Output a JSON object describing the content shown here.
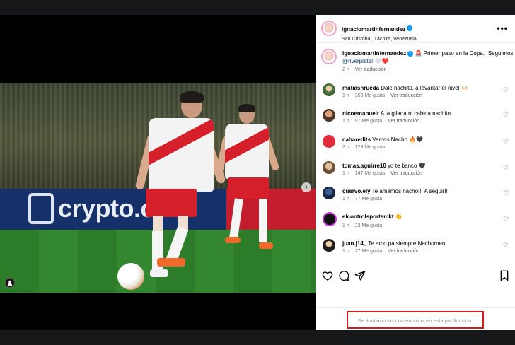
{
  "post": {
    "author": "ignaciomartinfernandez",
    "location": "San Cristóbal, Táchira, Venezuela",
    "caption_text": "🚨 Primer paso en la Copa. ¡Seguimos,",
    "caption_mention": "@riverplate!",
    "caption_emoji": "🤍❤️",
    "caption_time": "2 h",
    "caption_translate": "Ver traducción",
    "more_label": "•••"
  },
  "media": {
    "ad_text": "crypto.c",
    "next_glyph": "›",
    "tag_glyph": "👤"
  },
  "comments": [
    {
      "user": "matiasnrueda",
      "text": "Dale nachito, a levantar el nivel 🙌🏻",
      "time": "1 h",
      "likes": "353 Me gusta",
      "translate": "Ver traducción"
    },
    {
      "user": "nicoemanuelr",
      "text": "A la gilada ni cabida nachito",
      "time": "1 h",
      "likes": "97 Me gusta",
      "translate": "Ver traducción"
    },
    {
      "user": "cabaredits",
      "text": "Vamos Nacho 🔥🖤",
      "time": "2 h",
      "likes": "129 Me gusta",
      "translate": ""
    },
    {
      "user": "tomas.aguirre10",
      "text": "yo te banco 🖤",
      "time": "1 h",
      "likes": "147 Me gusta",
      "translate": "Ver traducción"
    },
    {
      "user": "cuervo.ely",
      "text": "Te amamos nacho!!! A seguir!!",
      "time": "1 h",
      "likes": "77 Me gusta",
      "translate": ""
    },
    {
      "user": "elcontrolsportsmkt",
      "text": "👏",
      "time": "1 h",
      "likes": "23 Me gusta",
      "translate": ""
    },
    {
      "user": "juan.j14_",
      "text": "Te amo pa siempre Nachomen",
      "time": "1 h",
      "likes": "77 Me gusta",
      "translate": "Ver traducción"
    }
  ],
  "footer": {
    "comments_closed": "Se limitaron los comentarios en esta publicación."
  },
  "colors": {
    "accent": "#0095f6",
    "highlight_box": "#d11b1b",
    "river_red": "#d51f2a"
  }
}
